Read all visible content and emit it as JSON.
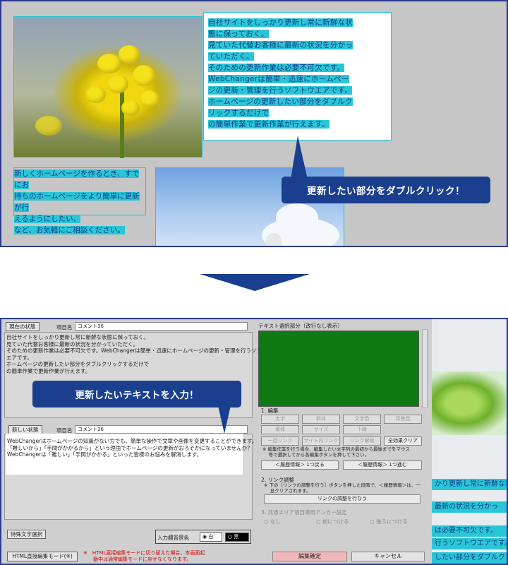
{
  "top": {
    "textbox_lines": [
      "自社サイトをしっかり更新し常に新鮮な状",
      "態に保っておく。",
      "見ていた代替お客様に最新の状況を分かっ",
      "ていただく。",
      "そのための更新作業は必要不可欠です。",
      "WebChangerは簡単・迅速にホームペー",
      "ジの更新・管理を行うソフトウエアです。",
      "ホームページの更新したい部分をダブルク",
      "リックするだけで",
      "の簡単作業で更新作業が行えます。"
    ],
    "left_lines": [
      "新しくホームページを作るとき、すでにお",
      "持ちのホームページをより簡単に更新が行",
      "えるようにしたい、",
      "など、お気軽にご相談ください。"
    ],
    "callout": "更新したい部分をダブルクリック！"
  },
  "bottom": {
    "current_state_label": "現在の状態",
    "item_name_label": "項目名",
    "item_name_value": "コメント36",
    "current_text": "自社サイトをしっかり更新し常に新鮮な状態に保っておく。\n見ていた代替お客様に最新の状況を分かっていただく。\nそのための更新作業は必要不可欠です。WebChangerは簡単・迅速にホームページの更新・管理を行うソフトウ\nエアです。\nホームページの更新したい部分をダブルクリックするだけで\nの簡単作業で更新作業が行えます。",
    "callout": "更新したいテキストを入力！",
    "new_state_label": "新しい状態",
    "new_item_name_label": "項目名",
    "new_item_name_value": "コメント36",
    "new_text": "WebChangerはホームページの知識がない方でも、簡単な操作で文章や画像を変更することができます。\n「難しいから」「手間がかかるから」という理由でホームページの更新がおろそかになっていませんか？\nWebChangerは「難しい」「手間がかかる」といった皆様のお悩みを解消します。",
    "text_selection_title": "テキスト選択部分（改行なし表示）",
    "edit_section": "1. 編集",
    "edit_buttons_row1": [
      "太字",
      "斜体",
      "文字色",
      "背景色"
    ],
    "edit_buttons_row2": [
      "書体",
      "サイズ",
      "下線"
    ],
    "edit_buttons_row3": [
      "一括リンク",
      "サイト内リンク",
      "リンク解除",
      "全効果クリア"
    ],
    "edit_note": "※ 編集作業を行う場合、編集したい文字列の最初から最後までをマウス\n　 等で選択してから各編集ボタンを押して下さい。",
    "history_back": "＜履歴情報＞ 1つ戻る",
    "history_forward": "＜履歴情報＞ 1つ進む",
    "link_section": "2. リンク調整",
    "link_note": "※ 下の［リンクの調整を行う］ボタンを押した段階で、＜履歴情報＞は、一\n　 旦クリアされます。",
    "link_button": "リンクの調整を行なう",
    "anchor_section": "3. 共通エリア項目専用アンカー設定",
    "anchor_options": [
      "なし",
      "前につける",
      "後ろにつける"
    ],
    "special_char_button": "特殊文字選択",
    "bg_color_label": "入力欄背景色",
    "bg_white": "白",
    "bg_black": "黒",
    "html_mode_button": "HTML直接編集モード(※)",
    "red_note": "※　HTML直接編集モードに切り替えた場合、本画面起\n　　動中は通常編集モードに戻せなくなります。",
    "confirm_button": "編集確定",
    "cancel_button": "キャンセル",
    "right_lines": [
      "かり更新し常に新鮮な状",
      "最新の状況を分かっ",
      "は必要不可欠です。",
      "行うソフトウエアです。",
      "したい部分をダブルク"
    ]
  },
  "colors": {
    "accent": "#1a3f8f",
    "highlight": "#29c6d6",
    "green_panel": "#0f7a13"
  }
}
